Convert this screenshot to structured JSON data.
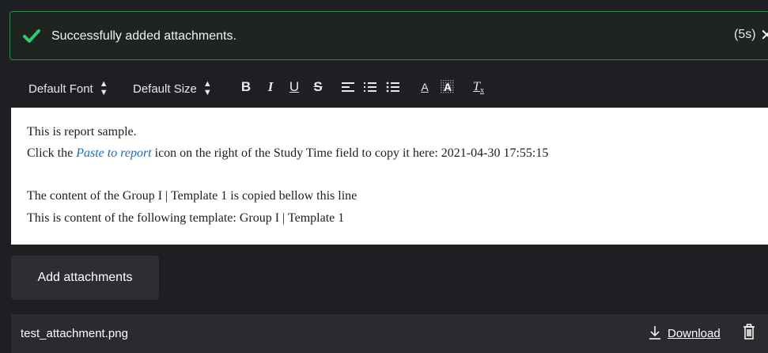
{
  "toast": {
    "message": "Successfully added attachments.",
    "countdown": "(5s)",
    "close_glyph": "✕",
    "status_color": "#2ecc71",
    "icon": "check-icon"
  },
  "toolbar": {
    "font_label": "Default Font",
    "size_label": "Default Size",
    "bold": "B",
    "italic": "I",
    "underline": "U",
    "strike": "S",
    "font_color": "A",
    "highlight": "A",
    "clear": "T",
    "icons": [
      "align-icon",
      "ordered-list-icon",
      "unordered-list-icon",
      "font-color-icon",
      "highlight-icon",
      "clear-format-icon"
    ]
  },
  "editor": {
    "line1": "This is report sample.",
    "line2_prefix": "Click the ",
    "line2_link": "Paste to report",
    "line2_suffix": " icon on the right of the Study Time field to copy it here: 2021-04-30 17:55:15",
    "line3": "The content of the Group I | Template 1 is copied bellow this line",
    "line4": "This is content of the following template: Group I | Template 1"
  },
  "add_button": {
    "label": "Add attachments"
  },
  "attachment": {
    "filename": "test_attachment.png",
    "download_label": "Download",
    "icons": [
      "download-icon",
      "trash-icon"
    ]
  }
}
